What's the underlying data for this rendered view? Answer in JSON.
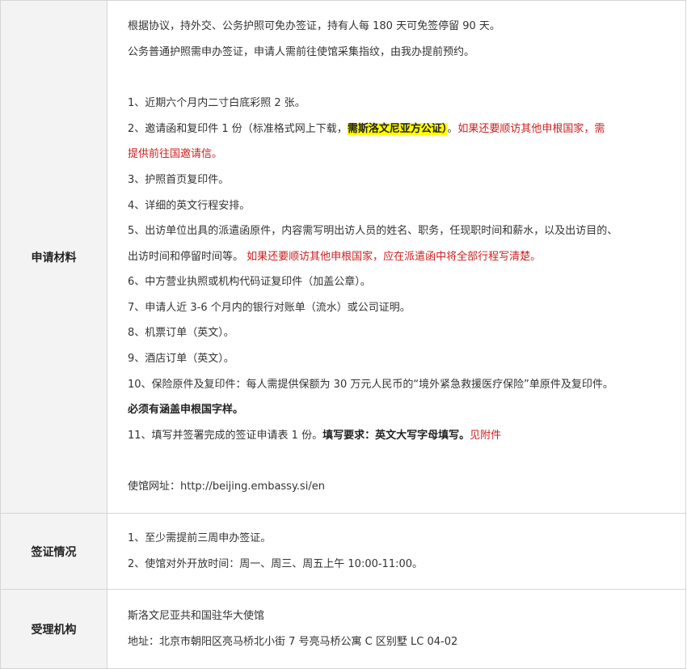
{
  "rows": {
    "materials": {
      "label": "申请材料",
      "intro": [
        "根据协议，持外交、公务护照可免办签证，持有人每 180 天可免签停留 90 天。",
        "公务普通护照需申办签证，申请人需前往使馆采集指纹，由我办提前预约。"
      ],
      "items": {
        "i1": "1、近期六个月内二寸白底彩照 2 张。",
        "i2_a": "2、邀请函和复印件 1 份（标准格式网上下载，",
        "i2_hl": "需斯洛文尼亚方公证）",
        "i2_b": "。",
        "i2_red": "如果还要顺访其他申根国家，需",
        "i2_red_cont": "提供前往国邀请信。",
        "i3": "3、护照首页复印件。",
        "i4": "4、详细的英文行程安排。",
        "i5_a": "5、出访单位出具的派遣函原件，内容需写明出访人员的姓名、职务，任现职时间和薪水，以及出访目的、",
        "i5_b": "出访时间和停留时间等。",
        "i5_red": "如果还要顺访其他申根国家，应在派遣函中将全部行程写清楚。",
        "i6": "6、中方营业执照或机构代码证复印件（加盖公章）。",
        "i7": "7、申请人近 3-6 个月内的银行对账单（流水）或公司证明。",
        "i8": "8、机票订单（英文）。",
        "i9": "9、酒店订单（英文）。",
        "i10_a": "10、保险原件及复印件：每人需提供保额为 30 万元人民币的“境外紧急救援医疗保险”单原件及复印件。",
        "i10_b": "必须有涵盖申根国字样。",
        "i11_a": "11、填写并签署完成的签证申请表 1 份。",
        "i11_bold": "填写要求：英文大写字母填写。",
        "i11_red": "见附件"
      },
      "website": "使馆网址：http://beijing.embassy.si/en"
    },
    "visa": {
      "label": "签证情况",
      "lines": [
        "1、至少需提前三周申办签证。",
        "2、使馆对外开放时间：周一、周三、周五上午 10:00-11:00。"
      ]
    },
    "agency": {
      "label": "受理机构",
      "lines": [
        "斯洛文尼亚共和国驻华大使馆",
        "地址：北京市朝阳区亮马桥北小街 7 号亮马桥公寓 C 区别墅 LC 04-02"
      ]
    }
  },
  "colors": {
    "border": "#d6d6d6",
    "label_bg": "#f3f3f3",
    "text": "#333333",
    "red": "#cc1f1f",
    "highlight": "#ffff00"
  }
}
